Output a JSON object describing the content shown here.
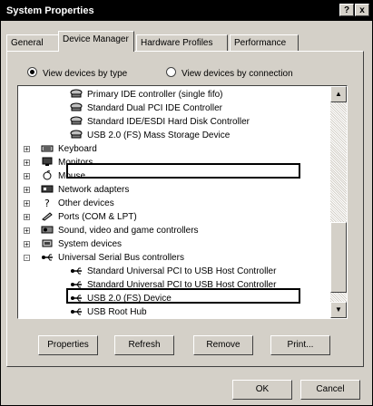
{
  "window": {
    "title": "System Properties",
    "help_btn": "?",
    "close_btn": "x"
  },
  "tabs": [
    "General",
    "Device Manager",
    "Hardware Profiles",
    "Performance"
  ],
  "view_options": [
    {
      "label": "View devices by type",
      "selected": true
    },
    {
      "label": "View devices by connection",
      "selected": false
    }
  ],
  "tree": {
    "items": [
      {
        "label": "Primary IDE controller (single fifo)",
        "icon": "controller-icon",
        "level": 2
      },
      {
        "label": "Standard Dual PCI IDE Controller",
        "icon": "controller-icon",
        "level": 2
      },
      {
        "label": "Standard IDE/ESDI Hard Disk Controller",
        "icon": "controller-icon",
        "level": 2
      },
      {
        "label": "USB 2.0 (FS) Mass Storage Device",
        "icon": "controller-icon",
        "level": 2,
        "highlighted": true
      },
      {
        "label": "Keyboard",
        "icon": "keyboard-icon",
        "level": 1,
        "expander": "+"
      },
      {
        "label": "Monitors",
        "icon": "monitor-icon",
        "level": 1,
        "expander": "+"
      },
      {
        "label": "Mouse",
        "icon": "mouse-icon",
        "level": 1,
        "expander": "+"
      },
      {
        "label": "Network adapters",
        "icon": "network-icon",
        "level": 1,
        "expander": "+"
      },
      {
        "label": "Other devices",
        "icon": "question-icon",
        "level": 1,
        "expander": "+"
      },
      {
        "label": "Ports (COM & LPT)",
        "icon": "port-icon",
        "level": 1,
        "expander": "+"
      },
      {
        "label": "Sound, video and game controllers",
        "icon": "sound-icon",
        "level": 1,
        "expander": "+"
      },
      {
        "label": "System devices",
        "icon": "system-icon",
        "level": 1,
        "expander": "+"
      },
      {
        "label": "Universal Serial Bus controllers",
        "icon": "usb-icon",
        "level": 1,
        "expander": "-"
      },
      {
        "label": "Standard Universal PCI to USB Host Controller",
        "icon": "usb-icon",
        "level": 2
      },
      {
        "label": "Standard Universal PCI to USB Host Controller",
        "icon": "usb-icon",
        "level": 2
      },
      {
        "label": "USB 2.0 (FS) Device",
        "icon": "usb-icon",
        "level": 2,
        "highlighted": true
      },
      {
        "label": "USB Root Hub",
        "icon": "usb-icon",
        "level": 2
      }
    ]
  },
  "buttons": {
    "properties": "Properties",
    "refresh": "Refresh",
    "remove": "Remove",
    "print": "Print...",
    "ok": "OK",
    "cancel": "Cancel"
  }
}
